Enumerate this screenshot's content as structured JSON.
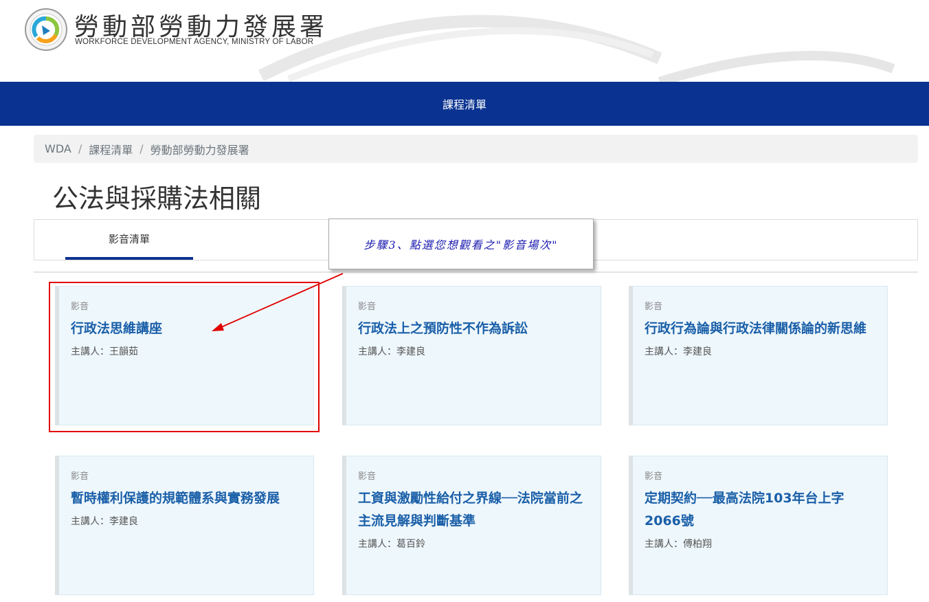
{
  "header": {
    "title": "勞動部勞動力發展署",
    "subtitle": "WORKFORCE DEVELOPMENT AGENCY, MINISTRY OF LABOR",
    "logo_icon": "wda-logo-icon"
  },
  "navbar": {
    "link": "課程清單",
    "color": "#0a3290"
  },
  "breadcrumb": {
    "items": [
      "WDA",
      "課程清單",
      "勞動部勞動力發展署"
    ],
    "separator": "/"
  },
  "page_title": "公法與採購法相關",
  "tabs": [
    {
      "label": "影音清單",
      "active": true
    }
  ],
  "callout": {
    "text": "步驟3、點選您想觀看之\"影音場次\""
  },
  "cards": [
    {
      "type": "影音",
      "title": "行政法思維講座",
      "speaker": "主講人：王韻茹"
    },
    {
      "type": "影音",
      "title": "行政法上之預防性不作為訴訟",
      "speaker": "主講人：李建良"
    },
    {
      "type": "影音",
      "title": "行政行為論與行政法律關係論的新思維",
      "speaker": "主講人：李建良"
    },
    {
      "type": "影音",
      "title": "暫時權利保護的規範體系與實務發展",
      "speaker": "主講人：李建良"
    },
    {
      "type": "影音",
      "title": "工資與激勵性給付之界線──法院當前之主流見解與判斷基準",
      "speaker": "主講人：葛百鈴"
    },
    {
      "type": "影音",
      "title": "定期契約──最高法院103年台上字2066號",
      "speaker": "主講人：傅柏翔"
    }
  ],
  "colors": {
    "accent": "#0a3290",
    "card_bg": "#eef7fc",
    "card_title": "#1a5fa8",
    "annotation_red": "#e00000",
    "callout_text": "#1a1ab0"
  }
}
